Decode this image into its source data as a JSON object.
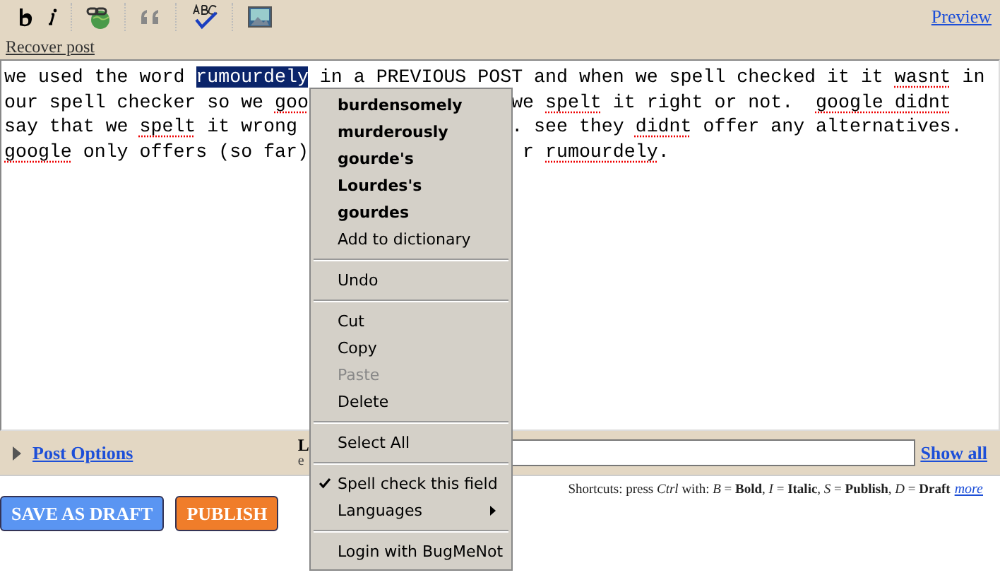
{
  "toolbar": {
    "preview": "Preview",
    "recover": "Recover post"
  },
  "editor": {
    "lines": [
      {
        "left": [
          {
            "text": "we used the word ",
            "misspelled": false,
            "selected": false
          },
          {
            "text": "rumourdely",
            "misspelled": false,
            "selected": true
          },
          {
            "text": " in a PREVIOUS POST and when we spell checked it it ",
            "misspelled": false,
            "selected": false
          },
          {
            "text": "wasnt",
            "misspelled": true,
            "selected": false
          },
          {
            "text": " in",
            "misspelled": false,
            "selected": false
          }
        ]
      },
      {
        "left": [
          {
            "text": "our spell checker so we ",
            "misspelled": false,
            "selected": false
          },
          {
            "text": "goo",
            "misspelled": true,
            "selected": false
          }
        ],
        "right": [
          {
            "text": "we ",
            "misspelled": false,
            "selected": false
          },
          {
            "text": "spelt",
            "misspelled": true,
            "selected": false
          },
          {
            "text": " it right or not.  ",
            "misspelled": false,
            "selected": false
          },
          {
            "text": "google ",
            "misspelled": true,
            "selected": false
          },
          {
            "text": "didnt",
            "misspelled": true,
            "selected": false
          }
        ]
      },
      {
        "left": [
          {
            "text": "say that we ",
            "misspelled": false,
            "selected": false
          },
          {
            "text": "spelt",
            "misspelled": true,
            "selected": false
          },
          {
            "text": " it wrong",
            "misspelled": false,
            "selected": false
          }
        ],
        "right": [
          {
            "text": ". see they ",
            "misspelled": false,
            "selected": false
          },
          {
            "text": "didnt",
            "misspelled": true,
            "selected": false
          },
          {
            "text": " offer any alternatives.",
            "misspelled": false,
            "selected": false
          }
        ]
      },
      {
        "left": [
          {
            "text": "google",
            "misspelled": true,
            "selected": false
          },
          {
            "text": " only offers (so far)",
            "misspelled": false,
            "selected": false
          }
        ],
        "right": [
          {
            "text": "r ",
            "misspelled": false,
            "selected": false
          },
          {
            "text": "rumourdely",
            "misspelled": true,
            "selected": false
          },
          {
            "text": ".",
            "misspelled": false,
            "selected": false
          }
        ]
      }
    ]
  },
  "options_bar": {
    "post_options": "Post Options",
    "label_title": "L",
    "label_hint": "e",
    "show_all": "Show all"
  },
  "shortcuts": {
    "text": "Shortcuts: press *Ctrl* with: *B* = **Bold**, *I* = **Italic**, *S* = **Publish**, *D* = **Draft**",
    "more": "more"
  },
  "buttons": [
    {
      "label": "SAVE AS DRAFT",
      "kind": "draft"
    },
    {
      "label": "PUBLISH",
      "kind": "publish"
    }
  ],
  "context_menu": [
    {
      "kind": "suggestion",
      "label": "burdensomely"
    },
    {
      "kind": "suggestion",
      "label": "murderously"
    },
    {
      "kind": "suggestion",
      "label": "gourde's"
    },
    {
      "kind": "suggestion",
      "label": "Lourdes's"
    },
    {
      "kind": "suggestion",
      "label": "gourdes"
    },
    {
      "kind": "item",
      "label": "Add to dictionary",
      "disabled": false
    },
    {
      "kind": "separator"
    },
    {
      "kind": "item",
      "label": "Undo",
      "disabled": false
    },
    {
      "kind": "separator"
    },
    {
      "kind": "item",
      "label": "Cut",
      "disabled": false
    },
    {
      "kind": "item",
      "label": "Copy",
      "disabled": false
    },
    {
      "kind": "item",
      "label": "Paste",
      "disabled": true
    },
    {
      "kind": "item",
      "label": "Delete",
      "disabled": false
    },
    {
      "kind": "separator"
    },
    {
      "kind": "item",
      "label": "Select All",
      "disabled": false
    },
    {
      "kind": "separator"
    },
    {
      "kind": "check",
      "label": "Spell check this field",
      "checked": true
    },
    {
      "kind": "submenu",
      "label": "Languages"
    },
    {
      "kind": "separator"
    },
    {
      "kind": "item",
      "label": "Login with BugMeNot",
      "disabled": false
    }
  ]
}
